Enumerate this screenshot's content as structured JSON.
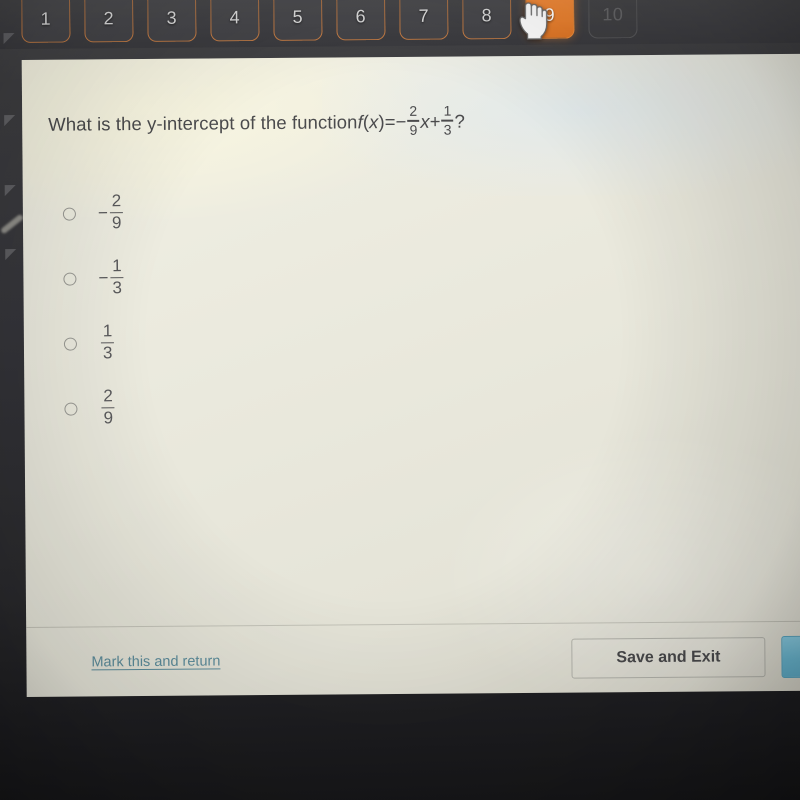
{
  "tabbar": {
    "tabs": [
      {
        "label": "1",
        "state": "available"
      },
      {
        "label": "2",
        "state": "available"
      },
      {
        "label": "3",
        "state": "available"
      },
      {
        "label": "4",
        "state": "available"
      },
      {
        "label": "5",
        "state": "available"
      },
      {
        "label": "6",
        "state": "available"
      },
      {
        "label": "7",
        "state": "available"
      },
      {
        "label": "8",
        "state": "available"
      },
      {
        "label": "9",
        "state": "active"
      },
      {
        "label": "10",
        "state": "disabled"
      }
    ],
    "cursor_icon": "pointing-hand-cursor",
    "accent_color": "#e8802f",
    "outline_color": "#c07a44",
    "bar_color": "#3f3f43"
  },
  "question": {
    "lead": "What is the y-intercept of the function ",
    "fn_name": "f",
    "fn_arg_open": "(",
    "fn_var": "x",
    "fn_arg_close": ")",
    "equals": " = ",
    "minus": "−",
    "coef_num": "2",
    "coef_den": "9",
    "variable": "x",
    "plus": " + ",
    "const_num": "1",
    "const_den": "3",
    "qmark": "?",
    "full_text": "What is the y-intercept of the function f(x) = -2/9x + 1/3?",
    "text_color": "#4b4b4d"
  },
  "options": [
    {
      "sign": "−",
      "num": "2",
      "den": "9",
      "selected": false,
      "label": "-2/9"
    },
    {
      "sign": "−",
      "num": "1",
      "den": "3",
      "selected": false,
      "label": "-1/3"
    },
    {
      "sign": "",
      "num": "1",
      "den": "3",
      "selected": false,
      "label": "1/3"
    },
    {
      "sign": "",
      "num": "2",
      "den": "9",
      "selected": false,
      "label": "2/9"
    }
  ],
  "footer": {
    "mark_link": "Mark this and return",
    "mark_link_color": "#5d8d9c",
    "save_exit": "Save and Exit",
    "next_button_color": "#6dbcd6"
  },
  "panel": {
    "background_color": "#ece b e0"
  }
}
